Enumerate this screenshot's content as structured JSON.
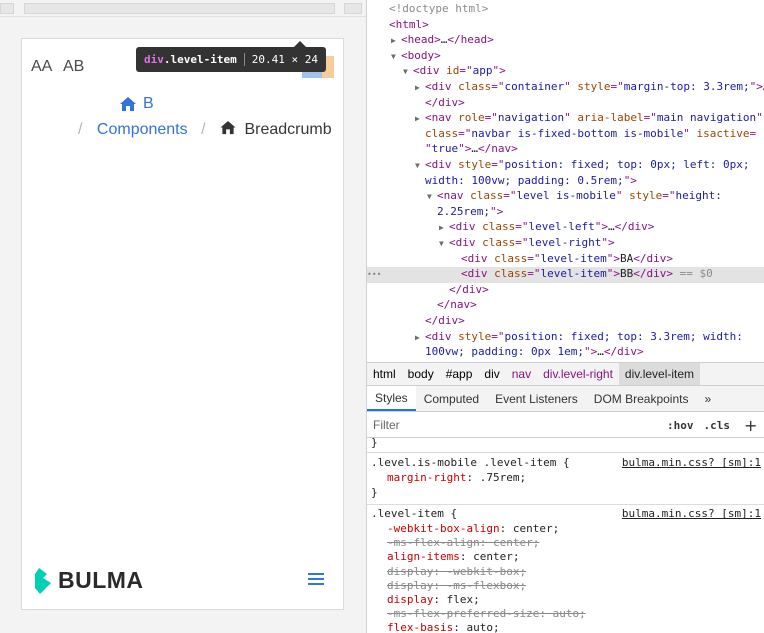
{
  "preview": {
    "level_items": [
      "AA",
      "AB",
      "BA",
      "BB"
    ],
    "tooltip": {
      "tag": "div",
      "class": ".level-item",
      "size": "20.41 × 24"
    },
    "breadcrumb": {
      "first_label_partial": "B",
      "separator": "/",
      "components": "Components",
      "current": "Breadcrumb"
    },
    "brand": "BULMA",
    "colors": {
      "link": "#3273dc",
      "brand_icon": "#00d1b2",
      "highlight_content": "#9fc4e7",
      "highlight_margin": "#f9cc9d"
    }
  },
  "devtools": {
    "dom_lines": [
      {
        "indent": 0,
        "tri": "",
        "parts": [
          [
            "cmt",
            "<!doctype html>"
          ]
        ]
      },
      {
        "indent": 0,
        "tri": "",
        "parts": [
          [
            "tag",
            "<html>"
          ]
        ]
      },
      {
        "indent": 1,
        "tri": "▶",
        "parts": [
          [
            "tag",
            "<head>"
          ],
          [
            "txt",
            "…"
          ],
          [
            "tag",
            "</head>"
          ]
        ]
      },
      {
        "indent": 1,
        "tri": "▼",
        "parts": [
          [
            "tag",
            "<body>"
          ]
        ]
      },
      {
        "indent": 2,
        "tri": "▼",
        "parts": [
          [
            "tag",
            "<div "
          ],
          [
            "attr",
            "id"
          ],
          [
            "tag",
            "=\""
          ],
          [
            "val",
            "app"
          ],
          [
            "tag",
            "\">"
          ]
        ]
      },
      {
        "indent": 3,
        "tri": "▶",
        "parts": [
          [
            "tag",
            "<div "
          ],
          [
            "attr",
            "class"
          ],
          [
            "tag",
            "=\""
          ],
          [
            "val",
            "container"
          ],
          [
            "tag",
            "\" "
          ],
          [
            "attr",
            "style"
          ],
          [
            "tag",
            "=\""
          ],
          [
            "val",
            "margin-top: 3.3rem;"
          ],
          [
            "tag",
            "\">"
          ],
          [
            "txt",
            "…"
          ]
        ]
      },
      {
        "indent": 3,
        "tri": "",
        "parts": [
          [
            "tag",
            "</div>"
          ]
        ]
      },
      {
        "indent": 3,
        "tri": "▶",
        "parts": [
          [
            "tag",
            "<nav "
          ],
          [
            "attr",
            "role"
          ],
          [
            "tag",
            "=\""
          ],
          [
            "val",
            "navigation"
          ],
          [
            "tag",
            "\" "
          ],
          [
            "attr",
            "aria-label"
          ],
          [
            "tag",
            "=\""
          ],
          [
            "val",
            "main navigation"
          ],
          [
            "tag",
            "\""
          ]
        ]
      },
      {
        "indent": 3,
        "tri": "",
        "parts": [
          [
            "attr",
            "class"
          ],
          [
            "tag",
            "=\""
          ],
          [
            "val",
            "navbar is-fixed-bottom is-mobile"
          ],
          [
            "tag",
            "\" "
          ],
          [
            "attr",
            "isactive"
          ],
          [
            "tag",
            "="
          ]
        ]
      },
      {
        "indent": 3,
        "tri": "",
        "parts": [
          [
            "tag",
            "\""
          ],
          [
            "val",
            "true"
          ],
          [
            "tag",
            "\">"
          ],
          [
            "txt",
            "…"
          ],
          [
            "tag",
            "</nav>"
          ]
        ]
      },
      {
        "indent": 3,
        "tri": "▼",
        "parts": [
          [
            "tag",
            "<div "
          ],
          [
            "attr",
            "style"
          ],
          [
            "tag",
            "=\""
          ],
          [
            "val",
            "position: fixed; top: 0px; left: 0px;"
          ]
        ]
      },
      {
        "indent": 3,
        "tri": "",
        "parts": [
          [
            "val",
            "width: 100vw; padding: 0.5rem;"
          ],
          [
            "tag",
            "\">"
          ]
        ]
      },
      {
        "indent": 4,
        "tri": "▼",
        "parts": [
          [
            "tag",
            "<nav "
          ],
          [
            "attr",
            "class"
          ],
          [
            "tag",
            "=\""
          ],
          [
            "val",
            "level is-mobile"
          ],
          [
            "tag",
            "\" "
          ],
          [
            "attr",
            "style"
          ],
          [
            "tag",
            "=\""
          ],
          [
            "val",
            "height:"
          ]
        ]
      },
      {
        "indent": 4,
        "tri": "",
        "parts": [
          [
            "val",
            "2.25rem;"
          ],
          [
            "tag",
            "\">"
          ]
        ]
      },
      {
        "indent": 5,
        "tri": "▶",
        "parts": [
          [
            "tag",
            "<div "
          ],
          [
            "attr",
            "class"
          ],
          [
            "tag",
            "=\""
          ],
          [
            "val",
            "level-left"
          ],
          [
            "tag",
            "\">"
          ],
          [
            "txt",
            "…"
          ],
          [
            "tag",
            "</div>"
          ]
        ]
      },
      {
        "indent": 5,
        "tri": "▼",
        "parts": [
          [
            "tag",
            "<div "
          ],
          [
            "attr",
            "class"
          ],
          [
            "tag",
            "=\""
          ],
          [
            "val",
            "level-right"
          ],
          [
            "tag",
            "\">"
          ]
        ]
      },
      {
        "indent": 6,
        "tri": "",
        "parts": [
          [
            "tag",
            "<div "
          ],
          [
            "attr",
            "class"
          ],
          [
            "tag",
            "=\""
          ],
          [
            "val",
            "level-item"
          ],
          [
            "tag",
            "\">"
          ],
          [
            "txt",
            "BA"
          ],
          [
            "tag",
            "</div>"
          ]
        ]
      },
      {
        "indent": 6,
        "tri": "",
        "sel": true,
        "parts": [
          [
            "tag",
            "<div "
          ],
          [
            "attr",
            "class"
          ],
          [
            "tag",
            "=\""
          ],
          [
            "val",
            "level-item"
          ],
          [
            "tag",
            "\">"
          ],
          [
            "txt",
            "BB"
          ],
          [
            "tag",
            "</div>"
          ],
          [
            "cmt",
            " == $0"
          ]
        ]
      },
      {
        "indent": 5,
        "tri": "",
        "parts": [
          [
            "tag",
            "</div>"
          ]
        ]
      },
      {
        "indent": 4,
        "tri": "",
        "parts": [
          [
            "tag",
            "</nav>"
          ]
        ]
      },
      {
        "indent": 3,
        "tri": "",
        "parts": [
          [
            "tag",
            "</div>"
          ]
        ]
      },
      {
        "indent": 3,
        "tri": "▶",
        "parts": [
          [
            "tag",
            "<div "
          ],
          [
            "attr",
            "style"
          ],
          [
            "tag",
            "=\""
          ],
          [
            "val",
            "position: fixed; top: 3.3rem; width:"
          ]
        ]
      },
      {
        "indent": 3,
        "tri": "",
        "parts": [
          [
            "val",
            "100vw; padding: 0px 1em;"
          ],
          [
            "tag",
            "\">"
          ],
          [
            "txt",
            "…"
          ],
          [
            "tag",
            "</div>"
          ]
        ]
      }
    ],
    "breadcrumbs": [
      "html",
      "body",
      "#app",
      "div",
      "nav",
      "div.level-right",
      "div.level-item"
    ],
    "tabs": [
      "Styles",
      "Computed",
      "Event Listeners",
      "DOM Breakpoints",
      "»"
    ],
    "filter_placeholder": "Filter",
    "hov": ":hov",
    "cls": ".cls",
    "plus": "+",
    "brace": "}",
    "rule1": {
      "selector": ".level.is-mobile .level-item {",
      "source": "bulma.min.css? [sm]:1",
      "decls": [
        {
          "name": "margin-right",
          "value": ".75rem;",
          "strike": false
        }
      ],
      "close": "}"
    },
    "rule2": {
      "selector": ".level-item {",
      "source": "bulma.min.css? [sm]:1",
      "decls": [
        {
          "name": "-webkit-box-align",
          "value": "center;",
          "strike": false
        },
        {
          "name": "-ms-flex-align",
          "value": "center;",
          "strike": true
        },
        {
          "name": "align-items",
          "value": "center;",
          "strike": false
        },
        {
          "name": "display",
          "value": "-webkit-box;",
          "strike": true
        },
        {
          "name": "display",
          "value": "-ms-flexbox;",
          "strike": true
        },
        {
          "name": "display",
          "value": "flex;",
          "strike": false
        },
        {
          "name": "-ms-flex-preferred-size",
          "value": "auto;",
          "strike": true
        },
        {
          "name": "flex-basis",
          "value": "auto;",
          "strike": false
        }
      ]
    }
  }
}
